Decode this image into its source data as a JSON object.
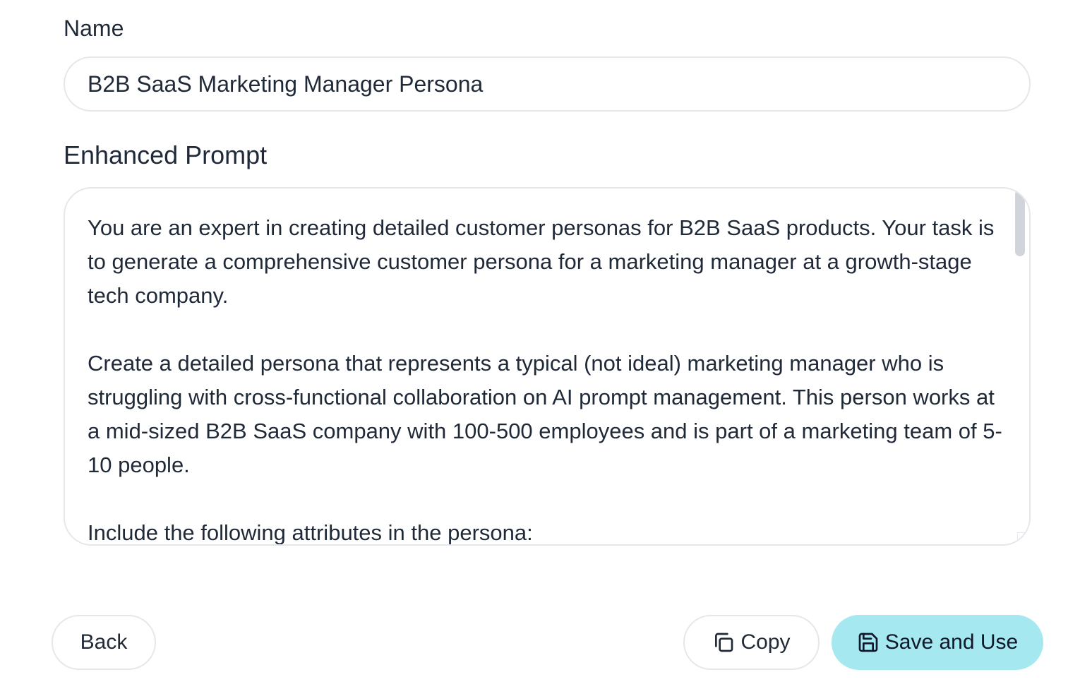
{
  "form": {
    "name_label": "Name",
    "name_value": "B2B SaaS Marketing Manager Persona",
    "prompt_label": "Enhanced Prompt",
    "prompt_text": "You are an expert in creating detailed customer personas for B2B SaaS products. Your task is to generate a comprehensive customer persona for a marketing manager at a growth-stage tech company.\n\nCreate a detailed persona that represents a typical (not ideal) marketing manager who is struggling with cross-functional collaboration on AI prompt management. This person works at a mid-sized B2B SaaS company with 100-500 employees and is part of a marketing team of 5-10 people.\n\nInclude the following attributes in the persona:"
  },
  "actions": {
    "back_label": "Back",
    "copy_label": "Copy",
    "save_label": "Save and Use"
  },
  "icons": {
    "copy": "copy-icon",
    "save": "save-icon"
  },
  "colors": {
    "primary_button": "#a5e8f0",
    "border": "#e5e7eb",
    "text": "#1f2937"
  }
}
